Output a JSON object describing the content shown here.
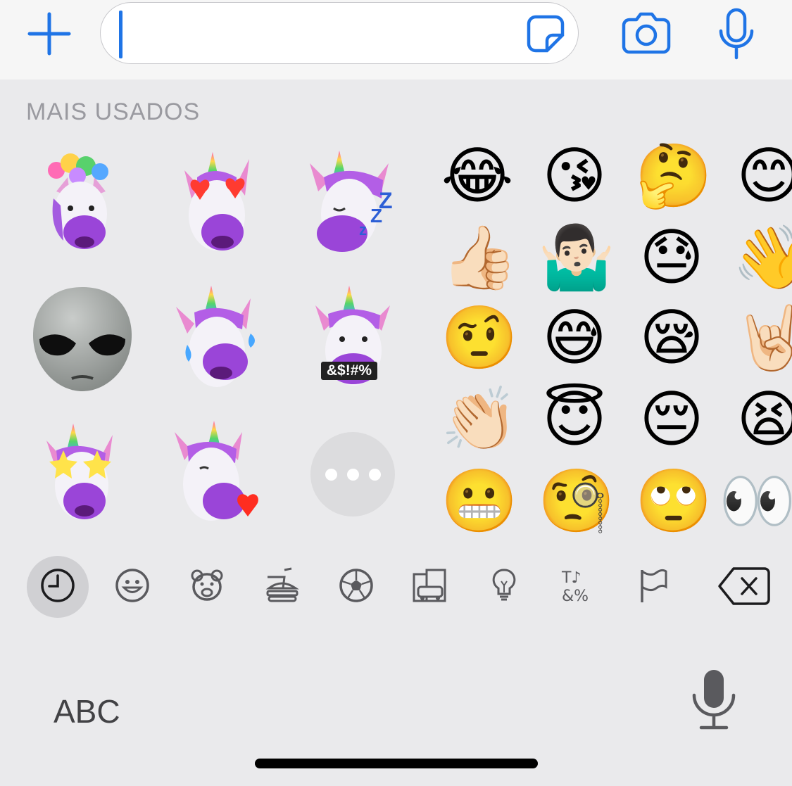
{
  "section": {
    "title": "MAIS USADOS"
  },
  "input": {
    "value": ""
  },
  "memojis": [
    {
      "name": "memoji-unicorn-mind-blown",
      "face": "purple-white"
    },
    {
      "name": "memoji-unicorn-heart-eyes",
      "face": "purple-white"
    },
    {
      "name": "memoji-unicorn-sleeping",
      "face": "purple-white"
    },
    {
      "name": "memoji-alien-angry",
      "face": "grey"
    },
    {
      "name": "memoji-unicorn-tears-of-joy",
      "face": "purple-white"
    },
    {
      "name": "memoji-unicorn-cursing",
      "face": "purple-white"
    },
    {
      "name": "memoji-unicorn-star-struck",
      "face": "purple-white"
    },
    {
      "name": "memoji-unicorn-kiss-heart",
      "face": "purple-white"
    }
  ],
  "memoji_tag": "&$!#%",
  "emojis": [
    "😂",
    "😘",
    "🤔",
    "😊",
    "👍🏻",
    "🤷🏻‍♂️",
    "😓",
    "👋",
    "🤨",
    "😅",
    "😪",
    "🤘🏻",
    "👏🏻",
    "😇",
    "😔",
    "😫",
    "😬",
    "🧐",
    "🙄",
    "👀"
  ],
  "categories": [
    {
      "name": "recent-icon",
      "active": true
    },
    {
      "name": "smileys-icon",
      "active": false
    },
    {
      "name": "animals-icon",
      "active": false
    },
    {
      "name": "food-icon",
      "active": false
    },
    {
      "name": "activity-icon",
      "active": false
    },
    {
      "name": "travel-icon",
      "active": false
    },
    {
      "name": "objects-icon",
      "active": false
    },
    {
      "name": "symbols-icon",
      "active": false
    },
    {
      "name": "flags-icon",
      "active": false
    }
  ],
  "bottom": {
    "abc_label": "ABC"
  },
  "colors": {
    "accent": "#1f74e6",
    "icon_grey": "#5a5a5e",
    "background": "#eaeaec"
  }
}
